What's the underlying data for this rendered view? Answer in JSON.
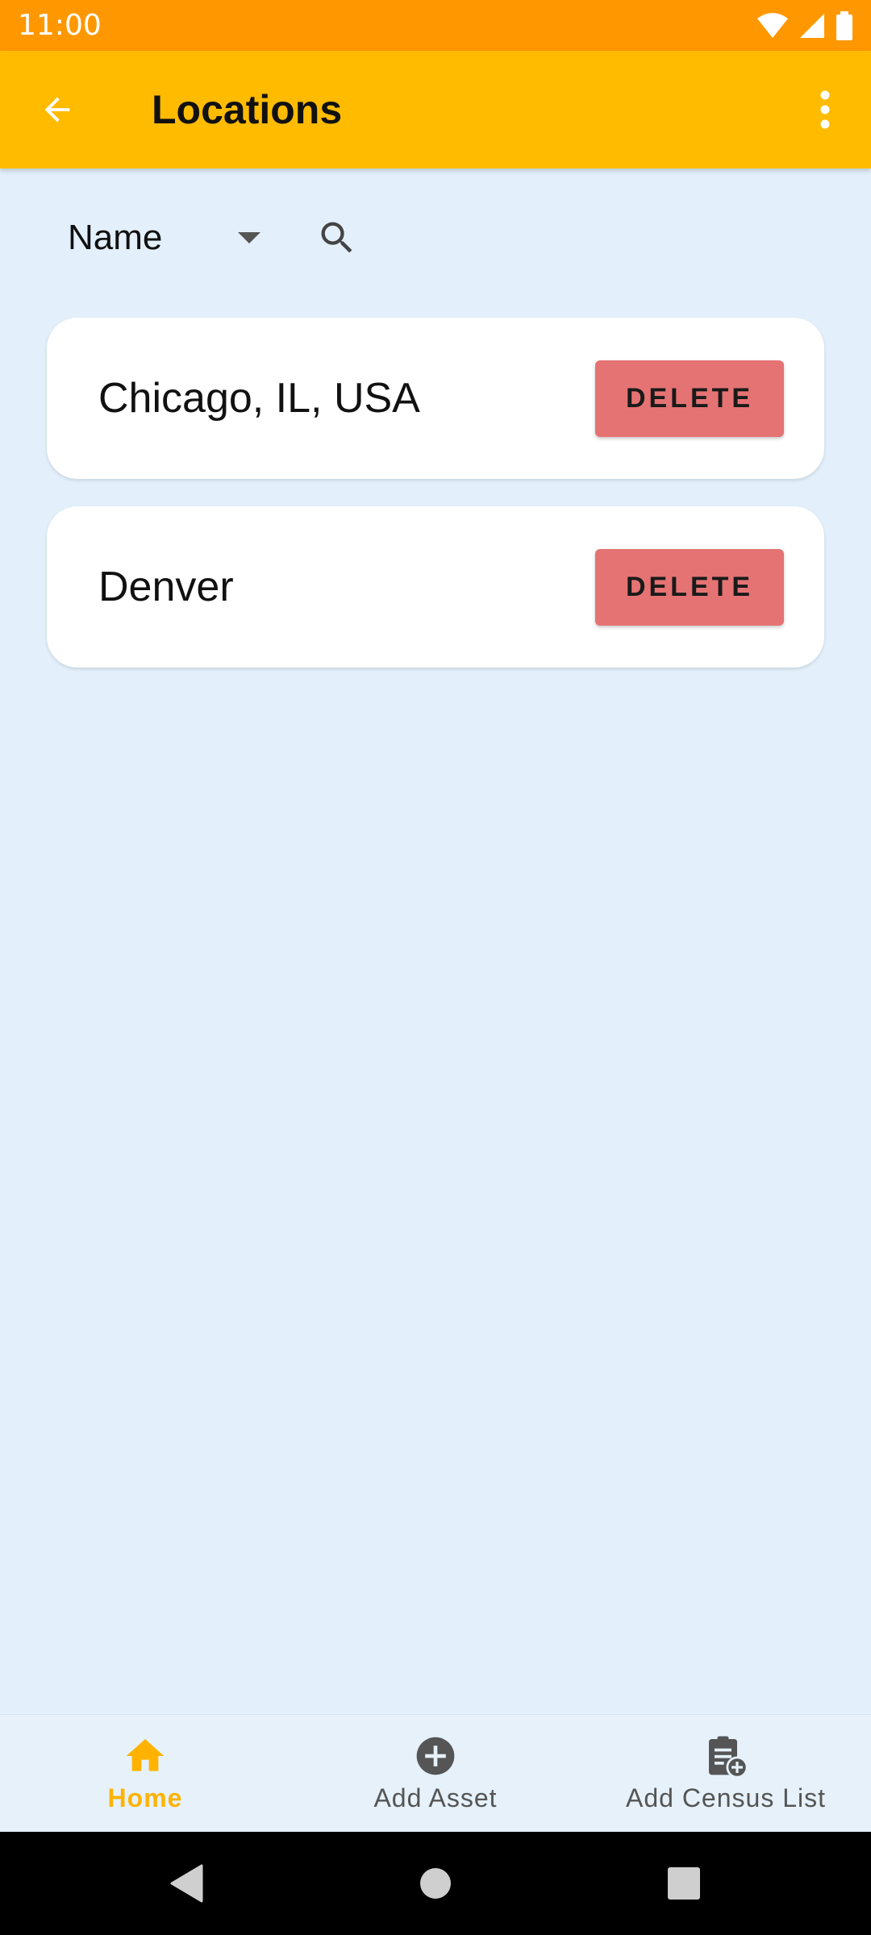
{
  "status_bar": {
    "time": "11:00"
  },
  "app_bar": {
    "title": "Locations"
  },
  "filter": {
    "sort_selected": "Name"
  },
  "locations": [
    {
      "name": "Chicago, IL, USA",
      "delete_label": "DELETE"
    },
    {
      "name": "Denver",
      "delete_label": "DELETE"
    }
  ],
  "bottom_nav": {
    "items": [
      {
        "label": "Home",
        "icon": "home-icon",
        "active": true
      },
      {
        "label": "Add Asset",
        "icon": "add-circle-icon",
        "active": false
      },
      {
        "label": "Add Census List",
        "icon": "clipboard-add-icon",
        "active": false
      }
    ]
  },
  "colors": {
    "status_bar": "#FF9800",
    "app_bar": "#FFBB00",
    "background": "#E3F0FB",
    "delete_button": "#E57373",
    "active_nav": "#FFB300"
  }
}
